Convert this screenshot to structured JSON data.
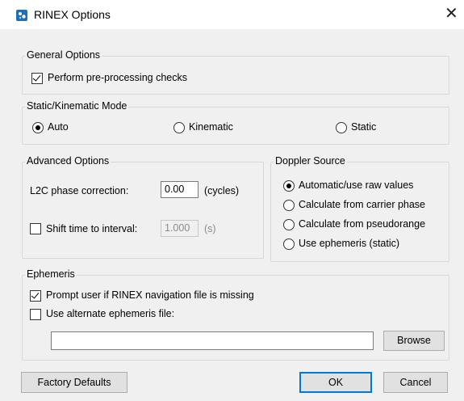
{
  "window": {
    "title": "RINEX Options",
    "close_label": "✕"
  },
  "general": {
    "legend": "General Options",
    "preprocess_label": "Perform pre-processing checks",
    "preprocess_checked": true
  },
  "mode": {
    "legend": "Static/Kinematic Mode",
    "options": [
      "Auto",
      "Kinematic",
      "Static"
    ],
    "selected": "Auto"
  },
  "advanced": {
    "legend": "Advanced Options",
    "l2c_label": "L2C phase correction:",
    "l2c_value": "0.00",
    "l2c_unit": "(cycles)",
    "shift_label": "Shift time to interval:",
    "shift_checked": false,
    "shift_value": "1.000",
    "shift_unit": "(s)"
  },
  "doppler": {
    "legend": "Doppler Source",
    "options": [
      "Automatic/use raw values",
      "Calculate from carrier phase",
      "Calculate from pseudorange",
      "Use ephemeris (static)"
    ],
    "selected": "Automatic/use raw values"
  },
  "ephemeris": {
    "legend": "Ephemeris",
    "prompt_label": "Prompt user if RINEX navigation file is missing",
    "prompt_checked": true,
    "alternate_label": "Use alternate ephemeris file:",
    "alternate_checked": false,
    "file_value": "",
    "browse_label": "Browse"
  },
  "footer": {
    "factory_label": "Factory Defaults",
    "ok_label": "OK",
    "cancel_label": "Cancel"
  },
  "colors": {
    "accent": "#0078d7",
    "app_icon": "#1e6fb5"
  }
}
